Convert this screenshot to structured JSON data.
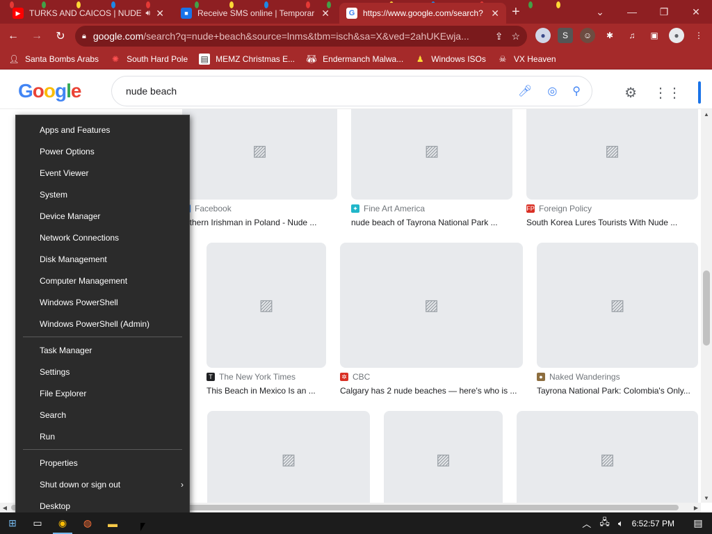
{
  "browser": {
    "tabs": [
      {
        "title": "TURKS AND CAICOS | NUDE",
        "favicon": "youtube-icon",
        "close": "✕"
      },
      {
        "title": "Receive SMS online | Temporar",
        "favicon": "sms-site-icon",
        "close": "✕"
      },
      {
        "title": "https://www.google.com/search?",
        "favicon": "google-icon",
        "close": "✕"
      }
    ],
    "new_tab": "+",
    "url_host": "google.com",
    "url_rest": "/search?q=nude+beach&source=lnms&tbm=isch&sa=X&ved=2ahUKEwja...",
    "bookmarks": [
      {
        "label": "Santa Bombs Arabs",
        "icon": "person-icon"
      },
      {
        "label": "South Hard Pole",
        "icon": "gear-icon"
      },
      {
        "label": "MEMZ Christmas E...",
        "icon": "page-icon"
      },
      {
        "label": "Endermanch Malwa...",
        "icon": "raccoon-icon"
      },
      {
        "label": "Windows ISOs",
        "icon": "figure-icon"
      },
      {
        "label": "VX Heaven",
        "icon": "skull-icon"
      }
    ],
    "colors": {
      "frame": "#8e1f22",
      "toolbar": "#a52a2a"
    }
  },
  "google": {
    "logo_letters": [
      "G",
      "o",
      "o",
      "g",
      "l",
      "e"
    ],
    "query": "nude beach",
    "results": [
      {
        "source": "Facebook",
        "caption": "orthern Irishman in Poland - Nude ...",
        "src_color": "#1877f2"
      },
      {
        "source": "Fine Art America",
        "caption": "nude beach of Tayrona National Park ...",
        "src_color": "#21b6c9"
      },
      {
        "source": "Foreign Policy",
        "caption": "South Korea Lures Tourists With Nude ...",
        "src_color": "#d93025"
      },
      {
        "source": "The New York Times",
        "caption": "This Beach in Mexico Is an ...",
        "src_color": "#202124"
      },
      {
        "source": "CBC",
        "caption": "Calgary has 2 nude beaches — here's who is ...",
        "src_color": "#d93025"
      },
      {
        "source": "Naked Wanderings",
        "caption": "Tayrona National Park: Colombia's Only...",
        "src_color": "#8d6e3f"
      }
    ]
  },
  "winx_menu": {
    "group1": [
      "Apps and Features",
      "Power Options",
      "Event Viewer",
      "System",
      "Device Manager",
      "Network Connections",
      "Disk Management",
      "Computer Management",
      "Windows PowerShell",
      "Windows PowerShell (Admin)"
    ],
    "group2": [
      "Task Manager",
      "Settings",
      "File Explorer",
      "Search",
      "Run"
    ],
    "group3": [
      "Properties",
      "Shut down or sign out",
      "Desktop"
    ]
  },
  "taskbar": {
    "clock": "6:52:57 PM"
  }
}
